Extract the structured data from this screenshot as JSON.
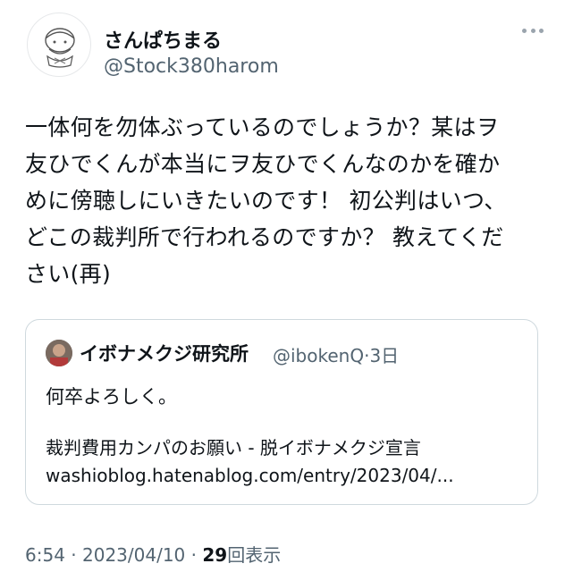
{
  "author": {
    "display_name": "さんぱちまる",
    "handle": "@Stock380harom",
    "avatar_icon": "hand-drawn-character-avatar"
  },
  "more_icon": "more-options-icon",
  "tweet": {
    "text": "一体何を勿体ぶっているのでしょうか？某はヲ\n友ひでくんが本当にヲ友ひでくんなのかを確か\nめに傍聴しにいきたいのです！ 初公判はいつ、\nどこの裁判所で行われるのですか？ 教えてくだ\nさい(再)"
  },
  "quoted": {
    "avatar_icon": "user-avatar",
    "display_name": "イボナメクジ研究所",
    "handle": "@ibokenQ",
    "separator": "·",
    "time": "3日",
    "text_line1": "何卒よろしく。",
    "link_title": "裁判費用カンパのお願い - 脱イボナメクジ宣言",
    "link_url": "washioblog.hatenablog.com/entry/2023/04/..."
  },
  "footer": {
    "time": "6:54",
    "separator": "·",
    "date": "2023/04/10",
    "views": "29",
    "views_label": "回表示"
  },
  "colors": {
    "text": "#0f1419",
    "secondary": "#536471",
    "border": "#cfd9de"
  }
}
